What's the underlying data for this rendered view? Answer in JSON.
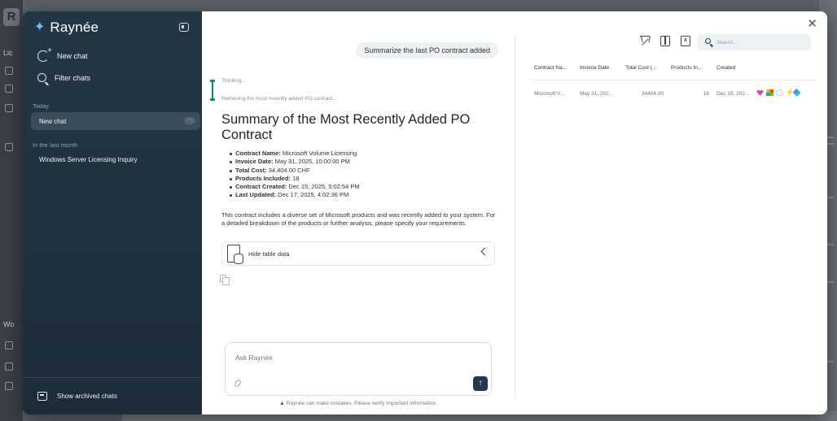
{
  "background": {
    "logo_letter": "R",
    "left_labels": [
      "Lic",
      "Wo"
    ]
  },
  "sidebar": {
    "brand_name": "Raynée",
    "new_chat_label": "New chat",
    "filter_chats_label": "Filter chats",
    "sections": [
      {
        "label": "Today",
        "items": [
          {
            "label": "New chat",
            "active": true,
            "more": "···"
          }
        ]
      },
      {
        "label": "In the last month",
        "items": [
          {
            "label": "Windows Server Licensing Inquiry",
            "active": false
          }
        ]
      }
    ],
    "archived_label": "Show archived chats"
  },
  "chat": {
    "user_message": "Summarize the last PO contract added",
    "thinking_label": "Thinking...",
    "thinking_step": "Retrieving the most recently added PO contract...",
    "summary_title": "Summary of the Most Recently Added PO Contract",
    "facts": [
      {
        "key": "Contract Name:",
        "value": " Microsoft Volume Licensing"
      },
      {
        "key": "Invoice Date:",
        "value": " May 31, 2025, 10:00:00 PM"
      },
      {
        "key": "Total Cost:",
        "value": " 34,404.00 CHF"
      },
      {
        "key": "Products Included:",
        "value": " 18"
      },
      {
        "key": "Contract Created:",
        "value": " Dec 15, 2025, 5:02:54 PM"
      },
      {
        "key": "Last Updated:",
        "value": " Dec 17, 2025, 4:02:36 PM"
      }
    ],
    "description": "This contract includes a diverse set of Microsoft products and was recently added to your system. For a detailed breakdown of the products or further analysis, please specify your requirements.",
    "table_toggle_label": "Hide table data",
    "composer_placeholder": "Ask Raynée",
    "send_icon": "↑",
    "disclaimer_icon": "▲",
    "disclaimer": "Raynée can make mistakes. Please verify important information."
  },
  "data_panel": {
    "close_icon": "✕",
    "toolbar_icons": [
      "filter-off-icon",
      "columns-icon",
      "excel-export-icon"
    ],
    "search_placeholder": "Search...",
    "columns": [
      "Contract Na...",
      "Invoice Date",
      "Total Cost (...",
      "Products In...",
      "Created"
    ],
    "rows": [
      {
        "contract_name": "Microsoft V...",
        "invoice_date": "May 31, 202...",
        "total_cost": "34404.00",
        "products": "18",
        "created": "Dec 15, 202..."
      }
    ],
    "row_icons": [
      "heart-icon",
      "microsoft-logo-icon",
      "ring-icon",
      "bolt-icon",
      "diamond-icon"
    ]
  }
}
